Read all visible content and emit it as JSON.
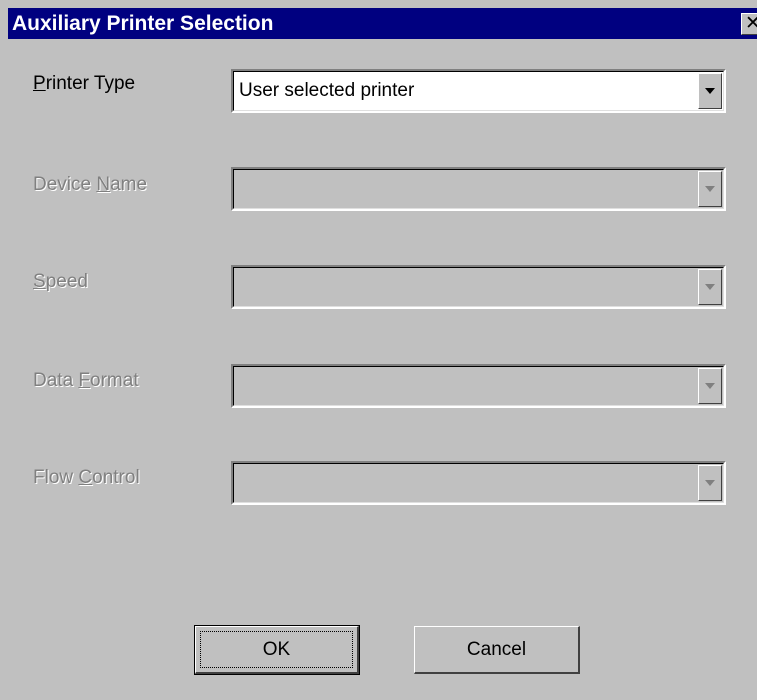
{
  "window": {
    "title": "Auxiliary Printer Selection",
    "close_glyph": "✕"
  },
  "fields": {
    "printer_type": {
      "label_first": "P",
      "label_rest": "rinter Type",
      "value": "User selected printer",
      "enabled": true
    },
    "device_name": {
      "label_pre": "Device ",
      "label_first": "N",
      "label_rest": "ame",
      "value": "",
      "enabled": false
    },
    "speed": {
      "label_first": "S",
      "label_rest": "peed",
      "value": "",
      "enabled": false
    },
    "data_format": {
      "label_pre": "Data ",
      "label_first": "F",
      "label_rest": "ormat",
      "value": "",
      "enabled": false
    },
    "flow_control": {
      "label_pre": "Flow ",
      "label_first": "C",
      "label_rest": "ontrol",
      "value": "",
      "enabled": false
    }
  },
  "buttons": {
    "ok_label": "OK",
    "cancel_label": "Cancel"
  },
  "icons": {
    "close": "close-icon",
    "dropdown": "chevron-down-icon"
  },
  "colors": {
    "titlebar": "#000080",
    "face": "#c0c0c0",
    "disabled_text": "#808080"
  }
}
